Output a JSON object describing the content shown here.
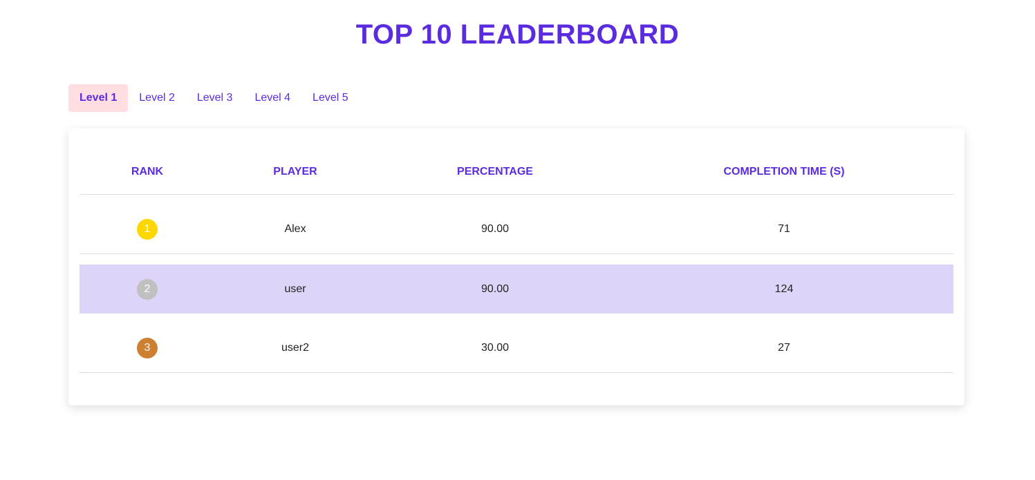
{
  "header": {
    "title": "TOP 10 LEADERBOARD"
  },
  "tabs": [
    {
      "label": "Level 1",
      "active": true
    },
    {
      "label": "Level 2",
      "active": false
    },
    {
      "label": "Level 3",
      "active": false
    },
    {
      "label": "Level 4",
      "active": false
    },
    {
      "label": "Level 5",
      "active": false
    }
  ],
  "table": {
    "columns": [
      "RANK",
      "PLAYER",
      "PERCENTAGE",
      "COMPLETION TIME (S)"
    ],
    "rows": [
      {
        "rank": "1",
        "player": "Alex",
        "percentage": "90.00",
        "time": "71",
        "badge_color": "#ffd700",
        "highlight": false
      },
      {
        "rank": "2",
        "player": "user",
        "percentage": "90.00",
        "time": "124",
        "badge_color": "#c0c0c0",
        "highlight": true
      },
      {
        "rank": "3",
        "player": "user2",
        "percentage": "30.00",
        "time": "27",
        "badge_color": "#cd7f32",
        "highlight": false
      }
    ]
  },
  "colors": {
    "accent": "#5b2be0",
    "active_tab_bg": "#ffdde1",
    "highlight_row_bg": "#ddd4f7"
  }
}
